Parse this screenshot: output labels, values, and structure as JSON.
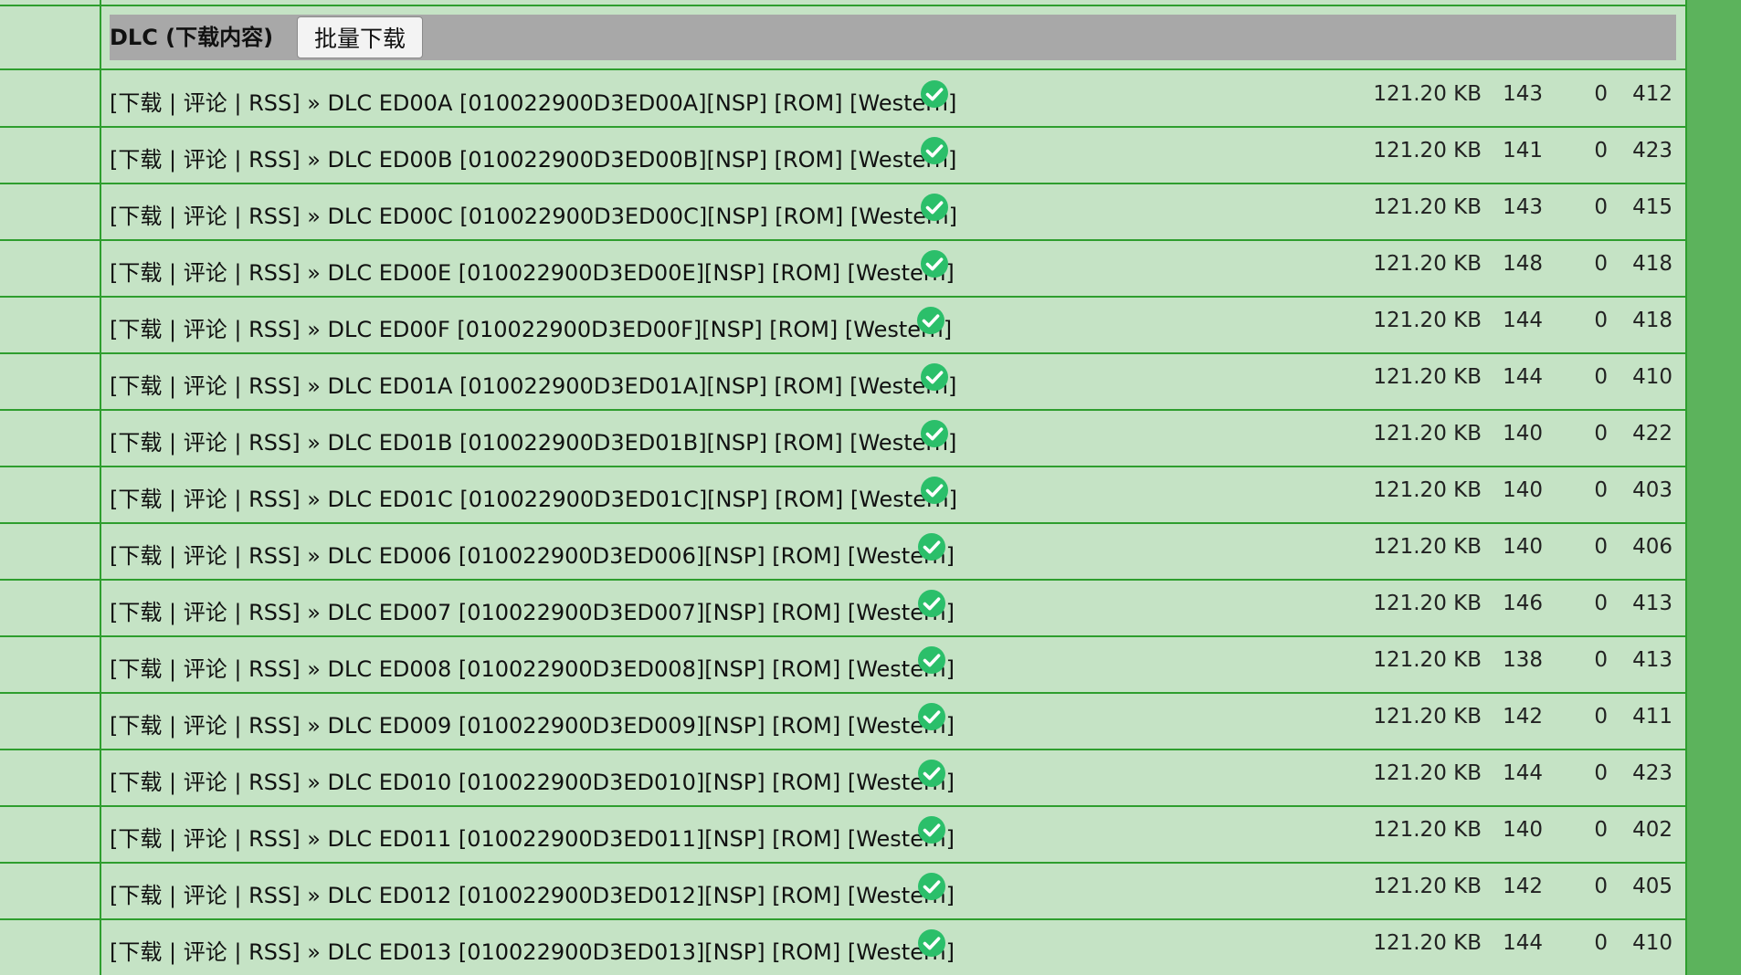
{
  "section": {
    "title": "DLC (下载内容)",
    "batch_button": "批量下载"
  },
  "colors": {
    "page_bg": "#5cb35c",
    "row_bg": "#c5e3c5",
    "grid_line": "#2e9e2e",
    "header_bg": "#a8a8a8",
    "check": "#2bbf6a"
  },
  "rows": [
    {
      "link_download": "下载",
      "link_comment": "评论",
      "link_rss": "RSS",
      "name": "DLC ED00A [010022900D3ED00A][NSP] [ROM] [Western]",
      "status_icon": "check-circle-icon",
      "size": "121.20 KB",
      "seeders": "143",
      "leechers": "0",
      "completed": "412"
    },
    {
      "link_download": "下载",
      "link_comment": "评论",
      "link_rss": "RSS",
      "name": "DLC ED00B [010022900D3ED00B][NSP] [ROM] [Western]",
      "status_icon": "check-circle-icon",
      "size": "121.20 KB",
      "seeders": "141",
      "leechers": "0",
      "completed": "423"
    },
    {
      "link_download": "下载",
      "link_comment": "评论",
      "link_rss": "RSS",
      "name": "DLC ED00C [010022900D3ED00C][NSP] [ROM] [Western]",
      "status_icon": "check-circle-icon",
      "size": "121.20 KB",
      "seeders": "143",
      "leechers": "0",
      "completed": "415"
    },
    {
      "link_download": "下载",
      "link_comment": "评论",
      "link_rss": "RSS",
      "name": "DLC ED00E [010022900D3ED00E][NSP] [ROM] [Western]",
      "status_icon": "check-circle-icon",
      "size": "121.20 KB",
      "seeders": "148",
      "leechers": "0",
      "completed": "418"
    },
    {
      "link_download": "下载",
      "link_comment": "评论",
      "link_rss": "RSS",
      "name": "DLC ED00F [010022900D3ED00F][NSP] [ROM] [Western]",
      "status_icon": "check-circle-icon",
      "size": "121.20 KB",
      "seeders": "144",
      "leechers": "0",
      "completed": "418"
    },
    {
      "link_download": "下载",
      "link_comment": "评论",
      "link_rss": "RSS",
      "name": "DLC ED01A [010022900D3ED01A][NSP] [ROM] [Western]",
      "status_icon": "check-circle-icon",
      "size": "121.20 KB",
      "seeders": "144",
      "leechers": "0",
      "completed": "410"
    },
    {
      "link_download": "下载",
      "link_comment": "评论",
      "link_rss": "RSS",
      "name": "DLC ED01B [010022900D3ED01B][NSP] [ROM] [Western]",
      "status_icon": "check-circle-icon",
      "size": "121.20 KB",
      "seeders": "140",
      "leechers": "0",
      "completed": "422"
    },
    {
      "link_download": "下载",
      "link_comment": "评论",
      "link_rss": "RSS",
      "name": "DLC ED01C [010022900D3ED01C][NSP] [ROM] [Western]",
      "status_icon": "check-circle-icon",
      "size": "121.20 KB",
      "seeders": "140",
      "leechers": "0",
      "completed": "403"
    },
    {
      "link_download": "下载",
      "link_comment": "评论",
      "link_rss": "RSS",
      "name": "DLC ED006 [010022900D3ED006][NSP] [ROM] [Western]",
      "status_icon": "check-circle-icon",
      "size": "121.20 KB",
      "seeders": "140",
      "leechers": "0",
      "completed": "406"
    },
    {
      "link_download": "下载",
      "link_comment": "评论",
      "link_rss": "RSS",
      "name": "DLC ED007 [010022900D3ED007][NSP] [ROM] [Western]",
      "status_icon": "check-circle-icon",
      "size": "121.20 KB",
      "seeders": "146",
      "leechers": "0",
      "completed": "413"
    },
    {
      "link_download": "下载",
      "link_comment": "评论",
      "link_rss": "RSS",
      "name": "DLC ED008 [010022900D3ED008][NSP] [ROM] [Western]",
      "status_icon": "check-circle-icon",
      "size": "121.20 KB",
      "seeders": "138",
      "leechers": "0",
      "completed": "413"
    },
    {
      "link_download": "下载",
      "link_comment": "评论",
      "link_rss": "RSS",
      "name": "DLC ED009 [010022900D3ED009][NSP] [ROM] [Western]",
      "status_icon": "check-circle-icon",
      "size": "121.20 KB",
      "seeders": "142",
      "leechers": "0",
      "completed": "411"
    },
    {
      "link_download": "下载",
      "link_comment": "评论",
      "link_rss": "RSS",
      "name": "DLC ED010 [010022900D3ED010][NSP] [ROM] [Western]",
      "status_icon": "check-circle-icon",
      "size": "121.20 KB",
      "seeders": "144",
      "leechers": "0",
      "completed": "423"
    },
    {
      "link_download": "下载",
      "link_comment": "评论",
      "link_rss": "RSS",
      "name": "DLC ED011 [010022900D3ED011][NSP] [ROM] [Western]",
      "status_icon": "check-circle-icon",
      "size": "121.20 KB",
      "seeders": "140",
      "leechers": "0",
      "completed": "402"
    },
    {
      "link_download": "下载",
      "link_comment": "评论",
      "link_rss": "RSS",
      "name": "DLC ED012 [010022900D3ED012][NSP] [ROM] [Western]",
      "status_icon": "check-circle-icon",
      "size": "121.20 KB",
      "seeders": "142",
      "leechers": "0",
      "completed": "405"
    },
    {
      "link_download": "下载",
      "link_comment": "评论",
      "link_rss": "RSS",
      "name": "DLC ED013 [010022900D3ED013][NSP] [ROM] [Western]",
      "status_icon": "check-circle-icon",
      "size": "121.20 KB",
      "seeders": "144",
      "leechers": "0",
      "completed": "410"
    }
  ]
}
